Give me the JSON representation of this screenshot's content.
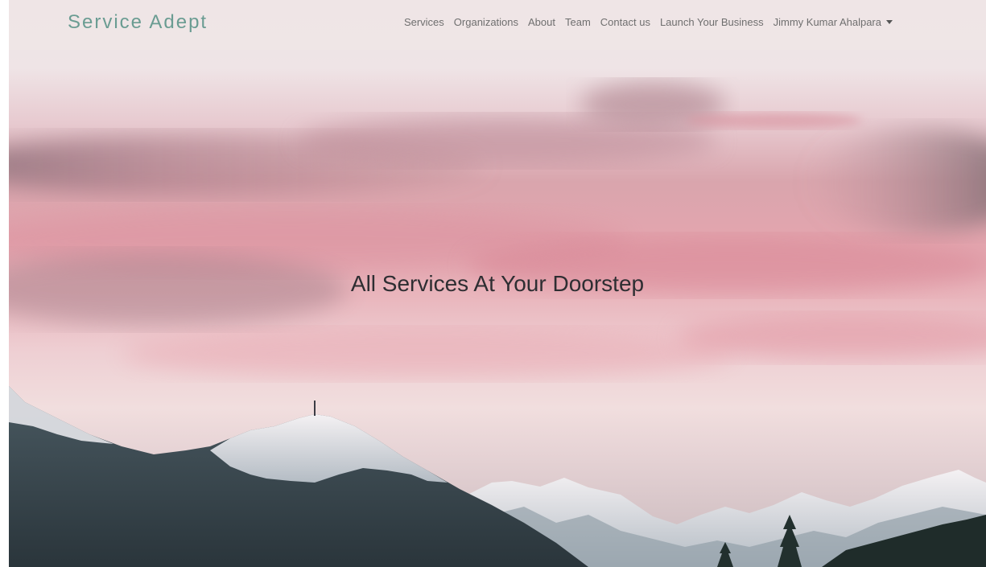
{
  "brand": {
    "name": "Service Adept"
  },
  "nav": {
    "items": [
      {
        "label": "Services"
      },
      {
        "label": "Organizations"
      },
      {
        "label": "About"
      },
      {
        "label": "Team"
      },
      {
        "label": "Contact us"
      },
      {
        "label": "Launch Your Business"
      }
    ],
    "user_menu": {
      "label": "Jimmy Kumar Ahalpara",
      "icon": "caret-down-icon"
    }
  },
  "hero": {
    "headline": "All Services At Your Doorstep",
    "background": "pink sunset sky over snowy mountains"
  },
  "colors": {
    "brand": "#6a9c92",
    "nav_text": "#6f6f6f",
    "headline": "#2e2e32",
    "sky_pink": "#e3a5ae"
  }
}
